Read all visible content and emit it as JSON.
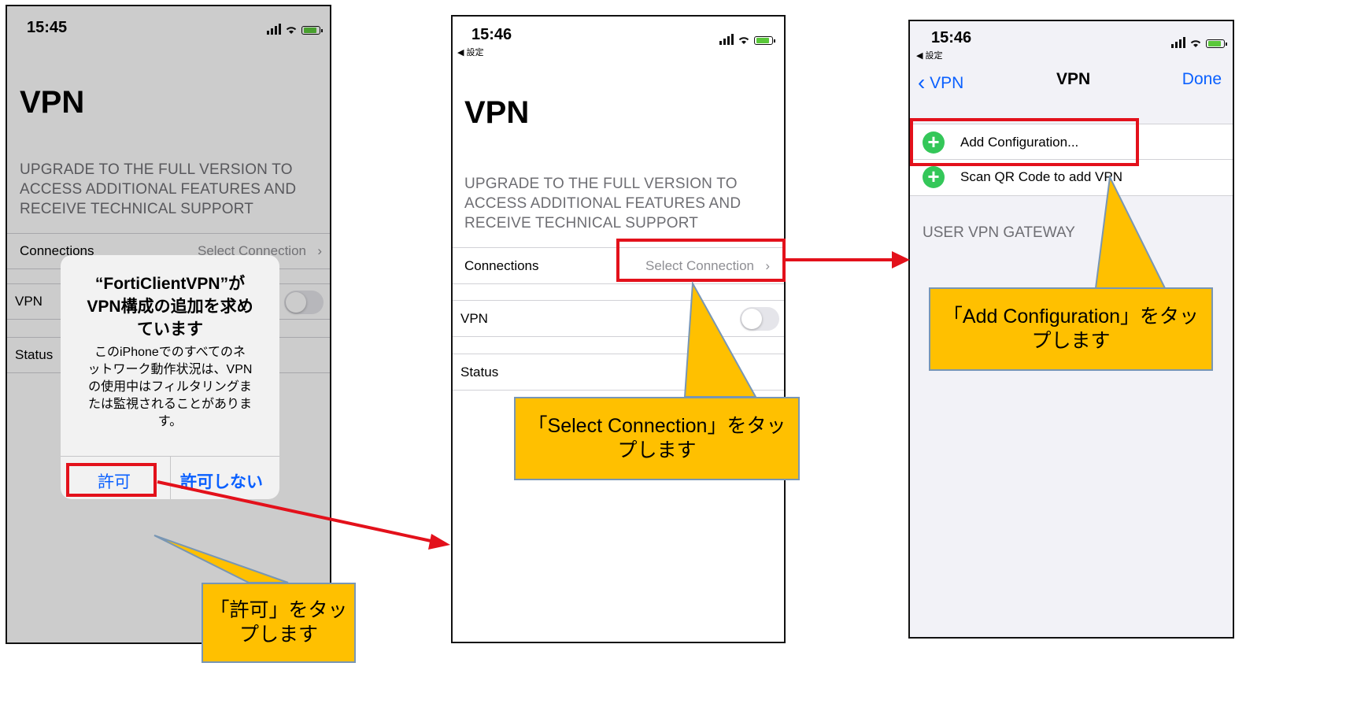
{
  "screen1": {
    "time": "15:45",
    "title": "VPN",
    "upgrade_text": [
      "UPGRADE TO THE FULL VERSION TO",
      "ACCESS ADDITIONAL FEATURES AND",
      "RECEIVE TECHNICAL SUPPORT"
    ],
    "connections_label": "Connections",
    "select_connection": "Select Connection",
    "vpn_label": "VPN",
    "status_label": "Status",
    "alert": {
      "title_lines": [
        "“FortiClientVPN”が",
        "VPN構成の追加を求め",
        "ています"
      ],
      "message_lines": [
        "このiPhoneでのすべてのネ",
        "ットワーク動作状況は、VPN",
        "の使用中はフィルタリングま",
        "たは監視されることがありま",
        "す。"
      ],
      "allow": "許可",
      "deny": "許可しない"
    },
    "callout_lines": [
      "「許可」をタッ",
      "プします"
    ]
  },
  "screen2": {
    "time": "15:46",
    "back_app": "◀ 設定",
    "title": "VPN",
    "upgrade_text": [
      "UPGRADE TO THE FULL VERSION TO",
      "ACCESS ADDITIONAL FEATURES AND",
      "RECEIVE TECHNICAL SUPPORT"
    ],
    "connections_label": "Connections",
    "select_connection": "Select Connection",
    "vpn_label": "VPN",
    "status_label": "Status",
    "callout_lines": [
      "「Select Connection」をタッ",
      "プします"
    ]
  },
  "screen3": {
    "time": "15:46",
    "back_app": "◀ 設定",
    "nav_back": "VPN",
    "nav_title": "VPN",
    "nav_done": "Done",
    "add_configuration": "Add Configuration...",
    "scan_qr": "Scan QR Code to add VPN",
    "section_header": "USER VPN GATEWAY",
    "callout_lines": [
      "「Add Configuration」をタッ",
      "プします"
    ]
  },
  "colors": {
    "highlight": "#e3111b",
    "callout": "#ffc000",
    "ios_blue": "#0a60ff",
    "add_green": "#34c759"
  }
}
